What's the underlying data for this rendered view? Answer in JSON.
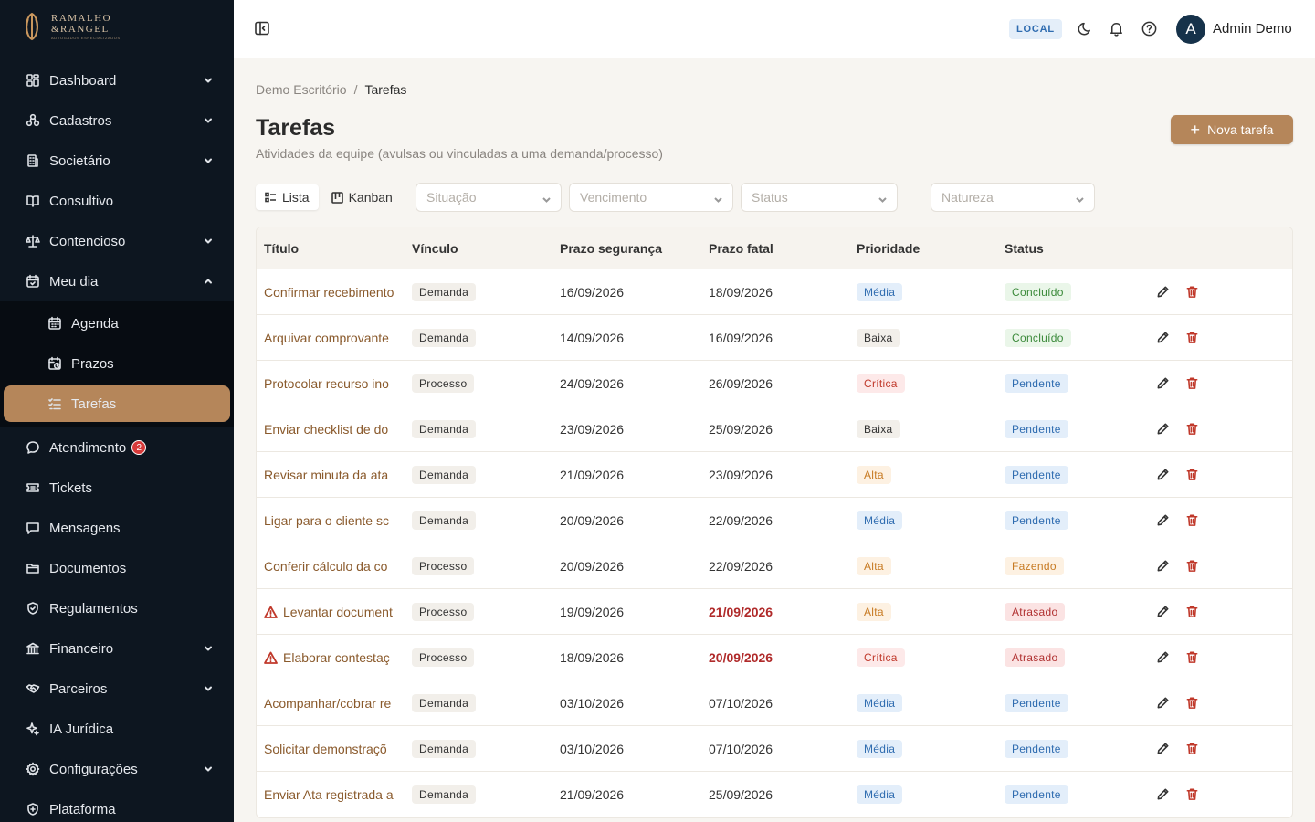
{
  "brand": {
    "line1": "RAMALHO",
    "line2": "&RANGEL",
    "line3": "ADVOGADOS ESPECIALIZADOS"
  },
  "colors": {
    "sidebar_bg": "#0d1620",
    "accent": "#b5865a",
    "title_link": "#8a5a2c",
    "danger": "#c0392b"
  },
  "sidebar": {
    "items": [
      {
        "label": "Dashboard",
        "icon": "dashboard-icon",
        "chevron": "down"
      },
      {
        "label": "Cadastros",
        "icon": "cadastros-icon",
        "chevron": "down"
      },
      {
        "label": "Societário",
        "icon": "building-icon",
        "chevron": "down"
      },
      {
        "label": "Consultivo",
        "icon": "book-icon"
      },
      {
        "label": "Contencioso",
        "icon": "scale-icon",
        "chevron": "down"
      },
      {
        "label": "Meu dia",
        "icon": "calendar-icon",
        "chevron": "up"
      }
    ],
    "submenu": [
      {
        "label": "Agenda",
        "icon": "calendar-small-icon"
      },
      {
        "label": "Prazos",
        "icon": "calendar-clock-icon"
      },
      {
        "label": "Tarefas",
        "icon": "checklist-icon",
        "active": true
      }
    ],
    "items_after": [
      {
        "label": "Atendimento",
        "icon": "chat-icon",
        "badge": "2"
      },
      {
        "label": "Tickets",
        "icon": "ticket-icon"
      },
      {
        "label": "Mensagens",
        "icon": "message-icon"
      },
      {
        "label": "Documentos",
        "icon": "folder-icon"
      },
      {
        "label": "Regulamentos",
        "icon": "shield-icon"
      },
      {
        "label": "Financeiro",
        "icon": "bank-icon",
        "chevron": "down"
      },
      {
        "label": "Parceiros",
        "icon": "handshake-icon",
        "chevron": "down"
      },
      {
        "label": "IA Jurídica",
        "icon": "sparkle-icon"
      },
      {
        "label": "Configurações",
        "icon": "gear-icon",
        "chevron": "down"
      },
      {
        "label": "Plataforma",
        "icon": "shield-icon"
      }
    ]
  },
  "header": {
    "env": "LOCAL",
    "avatar_initial": "A",
    "user_name": "Admin Demo"
  },
  "breadcrumb": {
    "root": "Demo Escritório",
    "sep": "/",
    "current": "Tarefas"
  },
  "page": {
    "title": "Tarefas",
    "subtitle": "Atividades da equipe (avulsas ou vinculadas a uma demanda/processo)",
    "new_button": "Nova tarefa"
  },
  "views": {
    "list": "Lista",
    "kanban": "Kanban"
  },
  "filters": {
    "situacao": "Situação",
    "vencimento": "Vencimento",
    "status": "Status",
    "natureza": "Natureza"
  },
  "table": {
    "columns": {
      "titulo": "Título",
      "vinculo": "Vínculo",
      "prazo_seguranca": "Prazo segurança",
      "prazo_fatal": "Prazo fatal",
      "prioridade": "Prioridade",
      "status": "Status"
    },
    "rows": [
      {
        "titulo": "Confirmar recebimento",
        "vinculo": "Demanda",
        "seg": "16/09/2026",
        "fatal": "18/09/2026",
        "prioridade": "Média",
        "pclass": "media",
        "status": "Concluído",
        "sclass": "concluido",
        "late": false
      },
      {
        "titulo": "Arquivar comprovante",
        "vinculo": "Demanda",
        "seg": "14/09/2026",
        "fatal": "16/09/2026",
        "prioridade": "Baixa",
        "pclass": "baixa",
        "status": "Concluído",
        "sclass": "concluido",
        "late": false
      },
      {
        "titulo": "Protocolar recurso ino",
        "vinculo": "Processo",
        "seg": "24/09/2026",
        "fatal": "26/09/2026",
        "prioridade": "Crítica",
        "pclass": "critica",
        "status": "Pendente",
        "sclass": "pendente",
        "late": false
      },
      {
        "titulo": "Enviar checklist de do",
        "vinculo": "Demanda",
        "seg": "23/09/2026",
        "fatal": "25/09/2026",
        "prioridade": "Baixa",
        "pclass": "baixa",
        "status": "Pendente",
        "sclass": "pendente",
        "late": false
      },
      {
        "titulo": "Revisar minuta da ata",
        "vinculo": "Demanda",
        "seg": "21/09/2026",
        "fatal": "23/09/2026",
        "prioridade": "Alta",
        "pclass": "alta",
        "status": "Pendente",
        "sclass": "pendente",
        "late": false
      },
      {
        "titulo": "Ligar para o cliente sc",
        "vinculo": "Demanda",
        "seg": "20/09/2026",
        "fatal": "22/09/2026",
        "prioridade": "Média",
        "pclass": "media",
        "status": "Pendente",
        "sclass": "pendente",
        "late": false
      },
      {
        "titulo": "Conferir cálculo da co",
        "vinculo": "Processo",
        "seg": "20/09/2026",
        "fatal": "22/09/2026",
        "prioridade": "Alta",
        "pclass": "alta",
        "status": "Fazendo",
        "sclass": "fazendo",
        "late": false
      },
      {
        "titulo": "Levantar document",
        "vinculo": "Processo",
        "seg": "19/09/2026",
        "fatal": "21/09/2026",
        "prioridade": "Alta",
        "pclass": "alta",
        "status": "Atrasado",
        "sclass": "atrasado",
        "late": true
      },
      {
        "titulo": "Elaborar contestaç",
        "vinculo": "Processo",
        "seg": "18/09/2026",
        "fatal": "20/09/2026",
        "prioridade": "Crítica",
        "pclass": "critica",
        "status": "Atrasado",
        "sclass": "atrasado",
        "late": true
      },
      {
        "titulo": "Acompanhar/cobrar re",
        "vinculo": "Demanda",
        "seg": "03/10/2026",
        "fatal": "07/10/2026",
        "prioridade": "Média",
        "pclass": "media",
        "status": "Pendente",
        "sclass": "pendente",
        "late": false
      },
      {
        "titulo": "Solicitar demonstraçõ",
        "vinculo": "Demanda",
        "seg": "03/10/2026",
        "fatal": "07/10/2026",
        "prioridade": "Média",
        "pclass": "media",
        "status": "Pendente",
        "sclass": "pendente",
        "late": false
      },
      {
        "titulo": "Enviar Ata registrada a",
        "vinculo": "Demanda",
        "seg": "21/09/2026",
        "fatal": "25/09/2026",
        "prioridade": "Média",
        "pclass": "media",
        "status": "Pendente",
        "sclass": "pendente",
        "late": false
      }
    ]
  }
}
